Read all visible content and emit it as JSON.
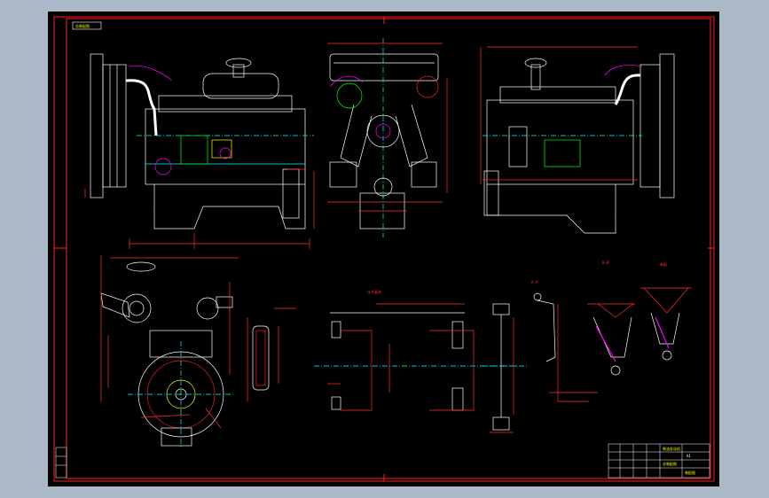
{
  "app": {
    "background_color": "#abb8c8",
    "canvas_color": "#000000"
  },
  "drawing": {
    "frame_color": "#ff2020",
    "line_color": "#ffffff",
    "dim_color": "#ff3030",
    "center_color": "#00ffff",
    "accent_color": "#ff00ff",
    "yellow_color": "#ffff00",
    "green_color": "#00ff00",
    "tag_top_left": "总装配图",
    "views": [
      {
        "id": "front-elevation"
      },
      {
        "id": "side-section"
      },
      {
        "id": "rear-elevation"
      },
      {
        "id": "flywheel-end-view"
      },
      {
        "id": "mount-detail"
      },
      {
        "id": "bracket-detail"
      },
      {
        "id": "support-detail"
      }
    ],
    "label_top_center": "技术要求",
    "label_bracket_a": "A-A",
    "label_bracket_b": "B-B",
    "label_small": "装配",
    "title_block": {
      "row1": "柴油发动机",
      "row2": "总装配图",
      "row3": "装配图",
      "sheet": "A1"
    }
  }
}
